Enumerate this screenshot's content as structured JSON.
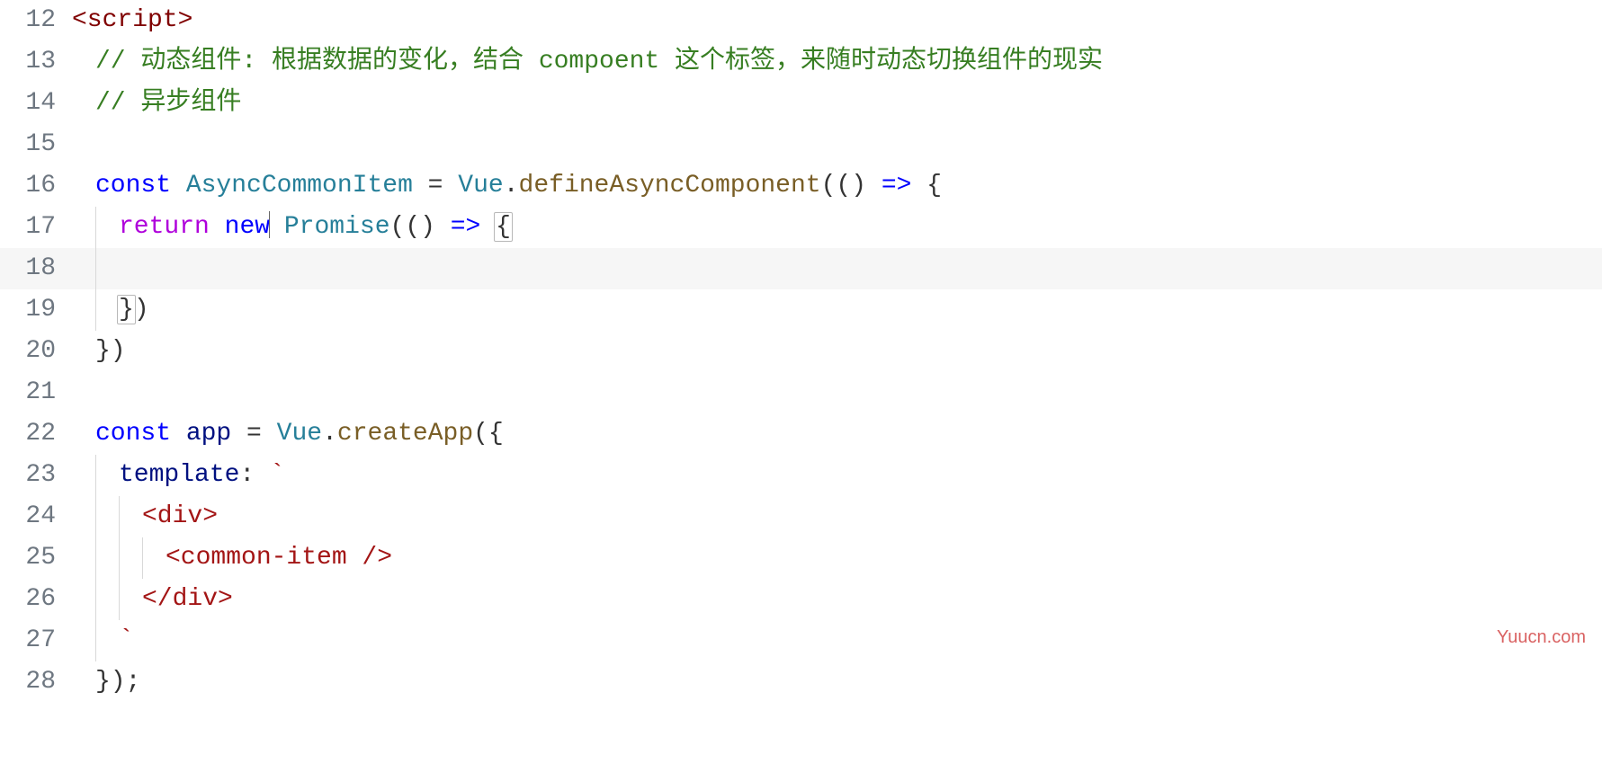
{
  "watermark": "Yuucn.com",
  "lines": [
    {
      "n": 12,
      "indent": 0,
      "active": false,
      "tokens": [
        {
          "cls": "tag",
          "t": "<script>"
        }
      ]
    },
    {
      "n": 13,
      "indent": 1,
      "active": false,
      "tokens": [
        {
          "cls": "cmt",
          "t": "// 动态组件: 根据数据的变化，结合 compoent 这个标签，来随时动态切换组件的现实"
        }
      ]
    },
    {
      "n": 14,
      "indent": 1,
      "active": false,
      "tokens": [
        {
          "cls": "cmt",
          "t": "// 异步组件"
        }
      ]
    },
    {
      "n": 15,
      "indent": 0,
      "active": false,
      "tokens": []
    },
    {
      "n": 16,
      "indent": 1,
      "active": false,
      "tokens": [
        {
          "cls": "kw",
          "t": "const"
        },
        {
          "cls": "punct",
          "t": " "
        },
        {
          "cls": "cls",
          "t": "AsyncCommonItem"
        },
        {
          "cls": "punct",
          "t": " = "
        },
        {
          "cls": "cls",
          "t": "Vue"
        },
        {
          "cls": "punct",
          "t": "."
        },
        {
          "cls": "fn",
          "t": "defineAsyncComponent"
        },
        {
          "cls": "punct",
          "t": "("
        },
        {
          "cls": "punct",
          "t": "() "
        },
        {
          "cls": "kw",
          "t": "=>"
        },
        {
          "cls": "punct",
          "t": " {"
        }
      ]
    },
    {
      "n": 17,
      "indent": 2,
      "active": false,
      "tokens": [
        {
          "cls": "ctl",
          "t": "return"
        },
        {
          "cls": "punct",
          "t": " "
        },
        {
          "cls": "kw",
          "t": "new"
        },
        {
          "cls": "caret",
          "t": ""
        },
        {
          "cls": "punct",
          "t": " "
        },
        {
          "cls": "cls",
          "t": "Promise"
        },
        {
          "cls": "punct",
          "t": "("
        },
        {
          "cls": "punct",
          "t": "() "
        },
        {
          "cls": "kw",
          "t": "=>"
        },
        {
          "cls": "punct",
          "t": " "
        },
        {
          "cls": "punct brace-hl",
          "t": "{"
        }
      ]
    },
    {
      "n": 18,
      "indent": 2,
      "active": true,
      "tokens": []
    },
    {
      "n": 19,
      "indent": 2,
      "active": false,
      "tokens": [
        {
          "cls": "punct brace-hl",
          "t": "}"
        },
        {
          "cls": "punct",
          "t": ")"
        }
      ]
    },
    {
      "n": 20,
      "indent": 1,
      "active": false,
      "tokens": [
        {
          "cls": "punct",
          "t": "})"
        }
      ]
    },
    {
      "n": 21,
      "indent": 0,
      "active": false,
      "tokens": []
    },
    {
      "n": 22,
      "indent": 1,
      "active": false,
      "tokens": [
        {
          "cls": "kw",
          "t": "const"
        },
        {
          "cls": "punct",
          "t": " "
        },
        {
          "cls": "id",
          "t": "app"
        },
        {
          "cls": "punct",
          "t": " = "
        },
        {
          "cls": "cls",
          "t": "Vue"
        },
        {
          "cls": "punct",
          "t": "."
        },
        {
          "cls": "fn",
          "t": "createApp"
        },
        {
          "cls": "punct",
          "t": "({"
        }
      ]
    },
    {
      "n": 23,
      "indent": 2,
      "active": false,
      "tokens": [
        {
          "cls": "id",
          "t": "template"
        },
        {
          "cls": "punct",
          "t": ": "
        },
        {
          "cls": "str",
          "t": "`"
        }
      ]
    },
    {
      "n": 24,
      "indent": 3,
      "active": false,
      "tokens": [
        {
          "cls": "str",
          "t": "<div>"
        }
      ]
    },
    {
      "n": 25,
      "indent": 4,
      "active": false,
      "tokens": [
        {
          "cls": "str",
          "t": "<common-item />"
        }
      ]
    },
    {
      "n": 26,
      "indent": 3,
      "active": false,
      "tokens": [
        {
          "cls": "str",
          "t": "</div>"
        }
      ]
    },
    {
      "n": 27,
      "indent": 2,
      "active": false,
      "tokens": [
        {
          "cls": "str",
          "t": "`"
        }
      ]
    },
    {
      "n": 28,
      "indent": 1,
      "active": false,
      "tokens": [
        {
          "cls": "punct",
          "t": "});"
        }
      ]
    }
  ],
  "indentUnitPx": 26
}
